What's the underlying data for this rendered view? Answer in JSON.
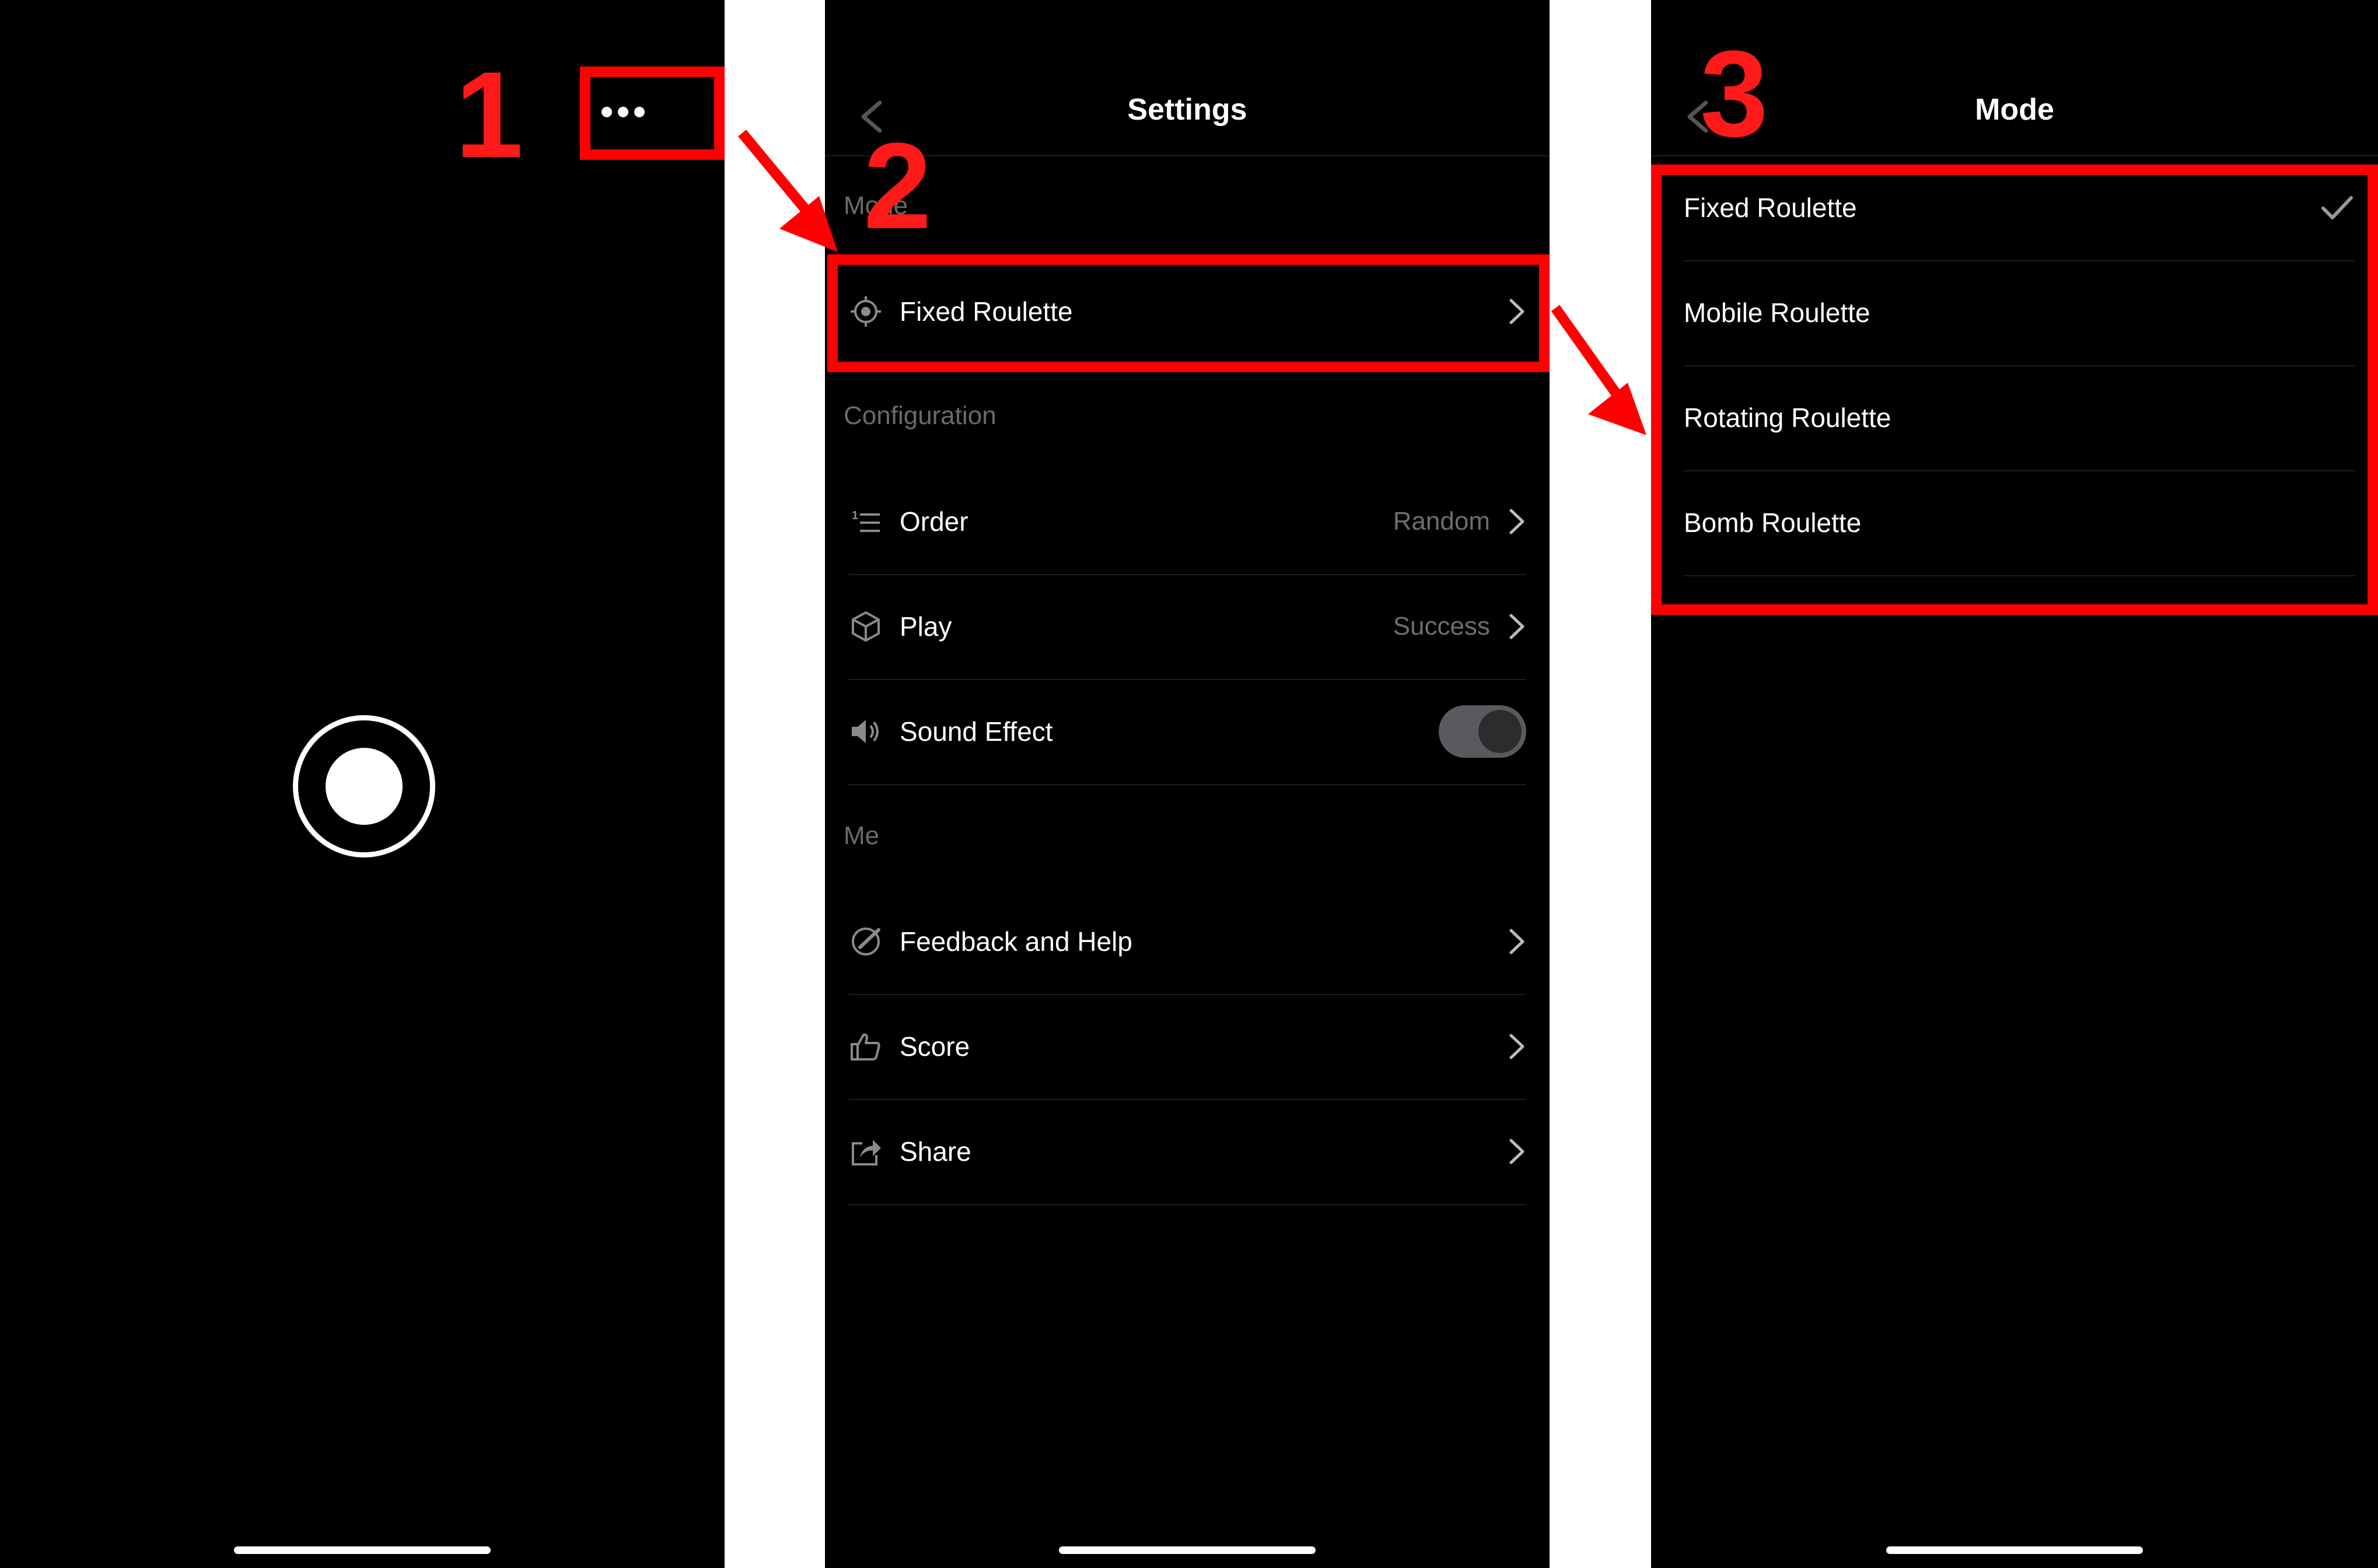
{
  "annotations": {
    "step1": "1",
    "step2": "2",
    "step3": "3"
  },
  "colors": {
    "annotation": "#ff0000",
    "background": "#000000",
    "text": "#ffffff",
    "secondary": "#6e6e6e"
  },
  "screen1": {
    "more_icon": "more-horizontal-icon",
    "shutter_icon": "record-button-icon"
  },
  "screen2": {
    "title": "Settings",
    "sections": {
      "mode": "Mode",
      "configuration": "Configuration",
      "me": "Me"
    },
    "items": [
      {
        "label": "Fixed Roulette",
        "value": "",
        "icon": "target-icon"
      },
      {
        "label": "Order",
        "value": "Random",
        "icon": "numbered-list-icon"
      },
      {
        "label": "Play",
        "value": "Success",
        "icon": "cube-icon"
      },
      {
        "label": "Sound Effect",
        "value": "",
        "icon": "speaker-icon",
        "toggle_on": false
      },
      {
        "label": "Feedback and Help",
        "value": "",
        "icon": "feedback-icon"
      },
      {
        "label": "Score",
        "value": "",
        "icon": "thumbs-up-icon"
      },
      {
        "label": "Share",
        "value": "",
        "icon": "share-icon"
      }
    ]
  },
  "screen3": {
    "title": "Mode",
    "options": [
      {
        "label": "Fixed Roulette",
        "selected": true
      },
      {
        "label": "Mobile Roulette",
        "selected": false
      },
      {
        "label": "Rotating Roulette",
        "selected": false
      },
      {
        "label": "Bomb Roulette",
        "selected": false
      }
    ]
  }
}
